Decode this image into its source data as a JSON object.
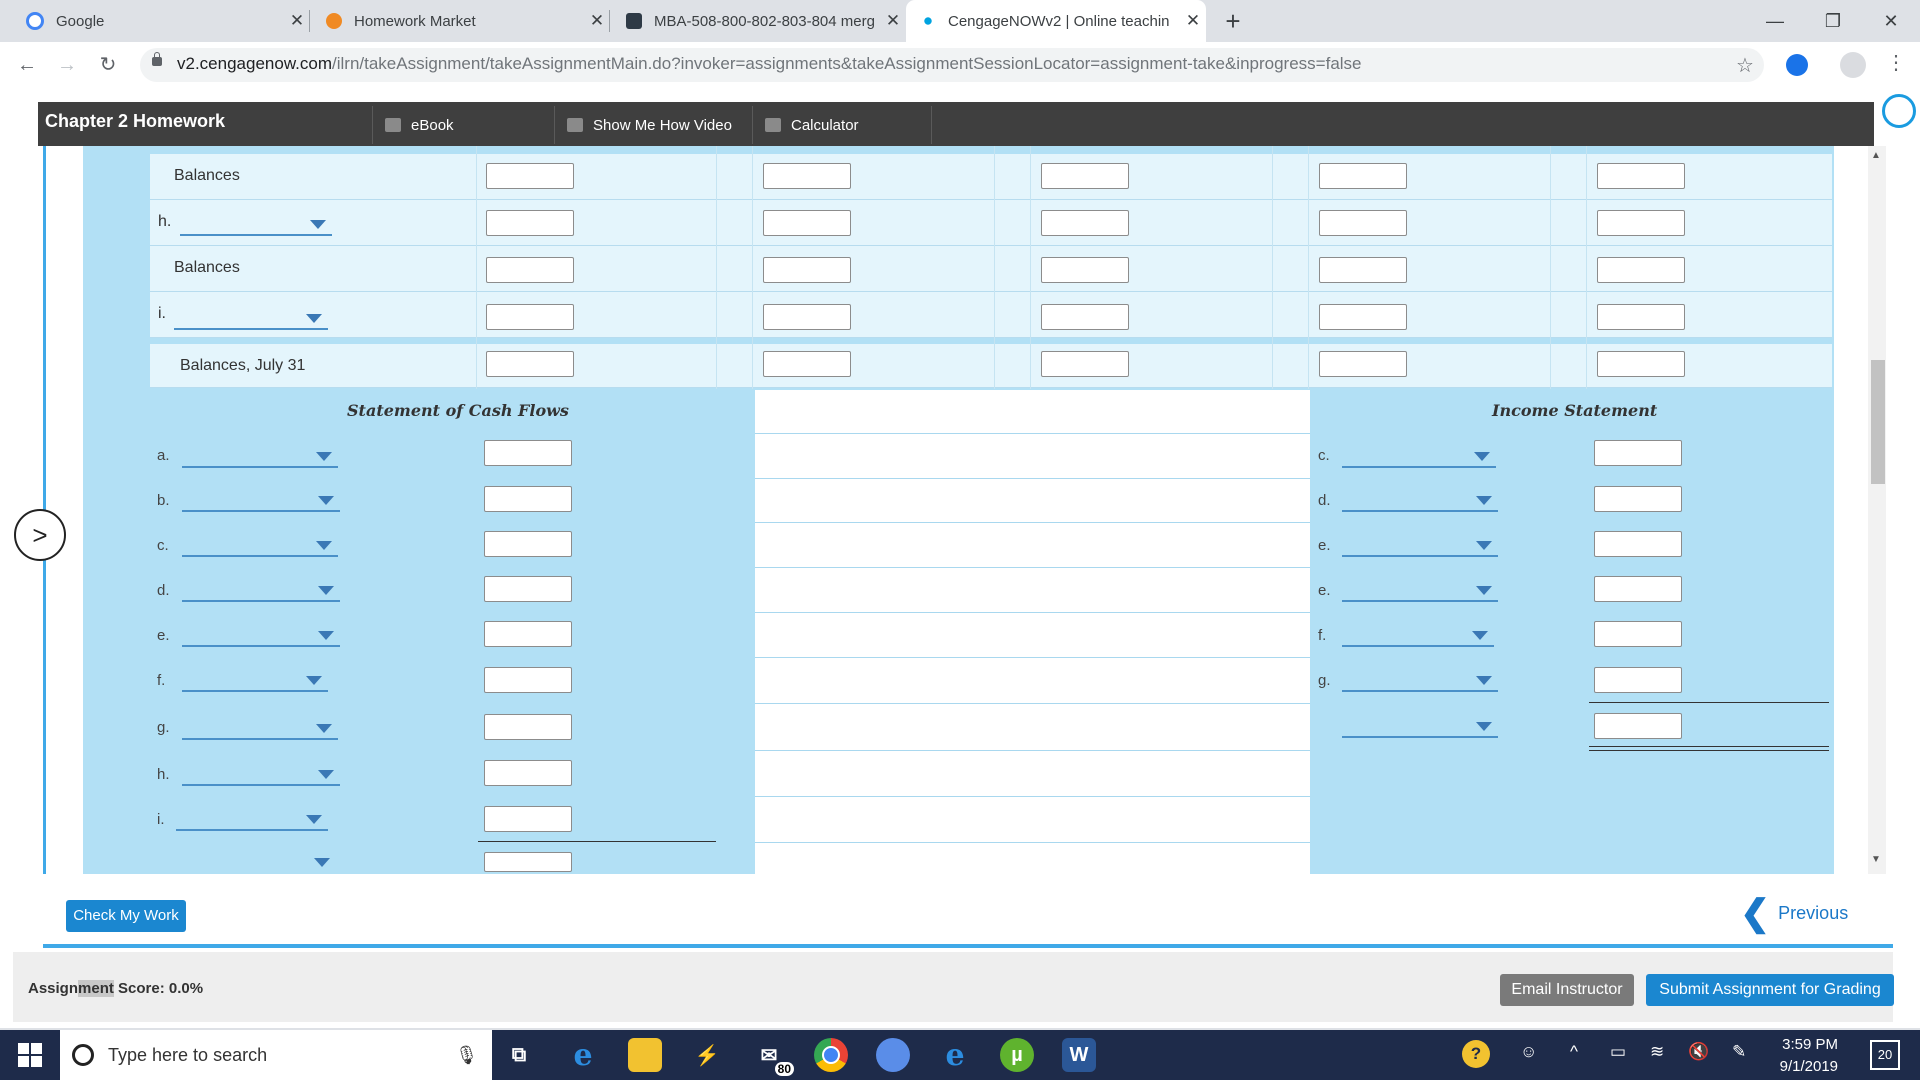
{
  "browser": {
    "tabs": [
      {
        "title": "Google",
        "fav_color": "#4285f4"
      },
      {
        "title": "Homework Market",
        "fav_color": "#f08a24"
      },
      {
        "title": "MBA-508-800-802-803-804 merg",
        "fav_color": "#2e3a46"
      },
      {
        "title": "CengageNOWv2 | Online teachin",
        "fav_color": "#00a3e0"
      }
    ],
    "url_host": "v2.cengagenow.com",
    "url_rest": "/ilrn/takeAssignment/takeAssignmentMain.do?invoker=assignments&takeAssignmentSessionLocator=assignment-take&inprogress=false"
  },
  "app": {
    "title": "Chapter 2 Homework",
    "toolbar": {
      "ebook": "eBook",
      "video": "Show Me How Video",
      "calculator": "Calculator"
    }
  },
  "equity_rows": {
    "row1_label": "Balances",
    "row2_letter": "h.",
    "row3_label": "Balances",
    "row4_letter": "i.",
    "row5_label": "Balances, July 31"
  },
  "cash_flows": {
    "title": "Statement of Cash Flows",
    "letters": [
      "a.",
      "b.",
      "c.",
      "d.",
      "e.",
      "f.",
      "g.",
      "h.",
      "i."
    ]
  },
  "income_statement": {
    "title": "Income Statement",
    "letters": [
      "c.",
      "d.",
      "e.",
      "e.",
      "f.",
      "g."
    ]
  },
  "footer": {
    "check_label": "Check My Work",
    "previous_label": "Previous",
    "score_prefix": "Assign",
    "score_highlight": "ment",
    "score_suffix": " Score: 0.0%",
    "email_label": "Email Instructor",
    "submit_label": "Submit Assignment for Grading"
  },
  "taskbar": {
    "search_placeholder": "Type here to search",
    "mail_badge": "80",
    "time": "3:59 PM",
    "date": "9/1/2019",
    "notif_count": "20"
  }
}
